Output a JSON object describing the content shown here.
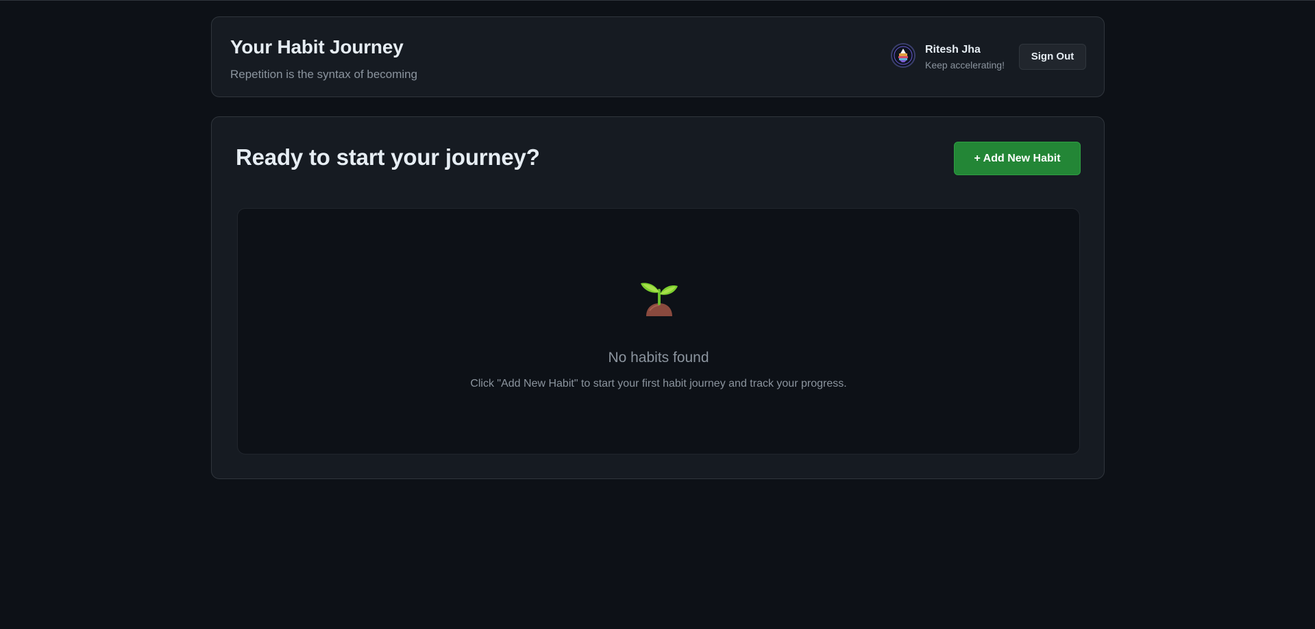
{
  "header": {
    "title": "Your Habit Journey",
    "subtitle": "Repetition is the syntax of becoming",
    "user": {
      "name": "Ritesh Jha",
      "tagline": "Keep accelerating!",
      "avatar_icon": "avatar-image"
    },
    "signout_label": "Sign Out"
  },
  "main": {
    "heading": "Ready to start your journey?",
    "add_button_label": "+ Add New Habit",
    "empty_state": {
      "icon": "sprout-icon",
      "title": "No habits found",
      "message": "Click \"Add New Habit\" to start your first habit journey and track your progress."
    }
  },
  "colors": {
    "background": "#0d1117",
    "card": "#161b22",
    "border": "#30363d",
    "primary_button": "#238636",
    "text": "#e6edf3",
    "muted_text": "#8b949e"
  }
}
